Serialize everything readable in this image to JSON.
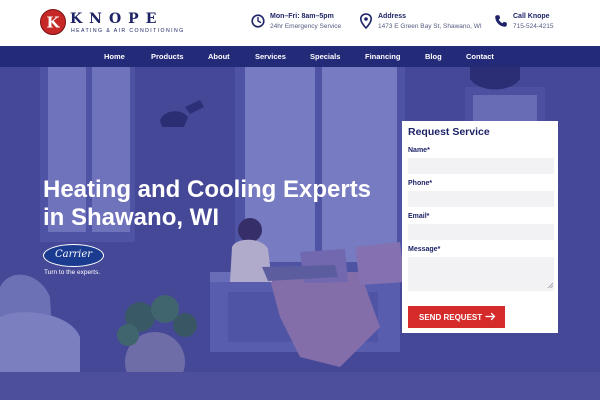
{
  "brand": {
    "logo_letter": "K",
    "name": "KNOPE",
    "tagline": "HEATING & AIR CONDITIONING",
    "colors": {
      "navy": "#232a78",
      "red": "#d62b2b",
      "hero_tint": "#4a4c9a"
    }
  },
  "header": {
    "hours": {
      "icon": "clock-icon",
      "title": "Mon–Fri: 8am–5pm",
      "subtitle": "24hr Emergency Service"
    },
    "address": {
      "icon": "map-pin-icon",
      "title": "Address",
      "subtitle": "1473 E Green Bay St, Shawano, WI"
    },
    "call": {
      "icon": "phone-icon",
      "title": "Call Knope",
      "subtitle": "715-524-4215"
    }
  },
  "nav": {
    "items": [
      {
        "label": "Home"
      },
      {
        "label": "Products"
      },
      {
        "label": "About"
      },
      {
        "label": "Services"
      },
      {
        "label": "Specials"
      },
      {
        "label": "Financing"
      },
      {
        "label": "Blog"
      },
      {
        "label": "Contact"
      }
    ]
  },
  "hero": {
    "headline": "Heating and Cooling Experts in Shawano, WI",
    "carrier_logo_text": "Carrier",
    "carrier_tagline": "Turn to the experts."
  },
  "form": {
    "title": "Request Service",
    "fields": {
      "name": {
        "label": "Name*",
        "value": ""
      },
      "phone": {
        "label": "Phone*",
        "value": ""
      },
      "email": {
        "label": "Email*",
        "value": ""
      },
      "message": {
        "label": "Message*",
        "value": ""
      }
    },
    "submit_label": "SEND REQUEST"
  }
}
